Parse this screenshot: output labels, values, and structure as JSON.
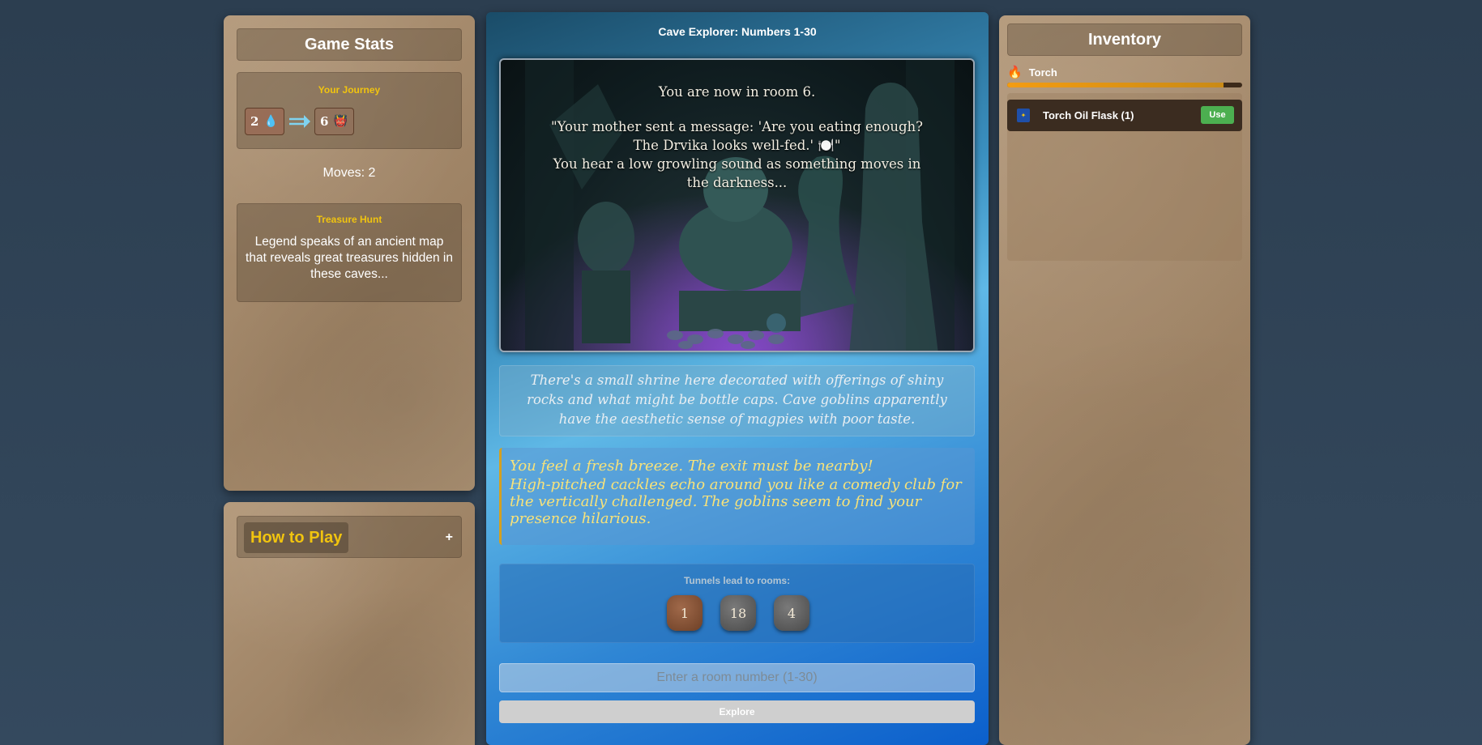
{
  "stats": {
    "title": "Game Stats",
    "journey": {
      "title": "Your Journey",
      "steps": [
        {
          "room": "2",
          "icon": "💧",
          "icon_name": "water-drop-icon"
        },
        {
          "room": "6",
          "icon": "👹",
          "icon_name": "goblin-icon"
        }
      ]
    },
    "moves": "Moves: 2",
    "treasure": {
      "title": "Treasure Hunt",
      "text": "Legend speaks of an ancient map that reveals great treasures hidden in these caves..."
    }
  },
  "howto": {
    "label": "How to Play",
    "toggle": "+"
  },
  "game": {
    "title": "Cave Explorer: Numbers 1-30",
    "scene": {
      "line1": "You are now in room 6.",
      "line2": "\"Your mother sent a message: 'Are you eating enough? The Drvika looks well-fed.' 🍽️\"",
      "line3": "You hear a low growling sound as something moves in the darkness..."
    },
    "description": "There's a small shrine here decorated with offerings of shiny rocks and what might be bottle caps. Cave goblins apparently have the aesthetic sense of magpies with poor taste.",
    "messages": [
      "You feel a fresh breeze. The exit must be nearby!",
      "High-pitched cackles echo around you like a comedy club for the vertically challenged. The goblins seem to find your presence hilarious."
    ],
    "tunnels": {
      "label": "Tunnels lead to rooms:",
      "rooms": [
        "1",
        "18",
        "4"
      ]
    },
    "input_placeholder": "Enter a room number (1-30)",
    "explore_label": "Explore"
  },
  "inventory": {
    "title": "Inventory",
    "torch": {
      "icon": "🔥",
      "label": "Torch",
      "level": 0.92
    },
    "items": [
      {
        "name": "Torch Oil Flask (1)",
        "action": "Use"
      }
    ]
  },
  "colors": {
    "accent_gold": "#f1c40f",
    "use_green": "#4caf50",
    "torch_orange": "#f39c12"
  }
}
